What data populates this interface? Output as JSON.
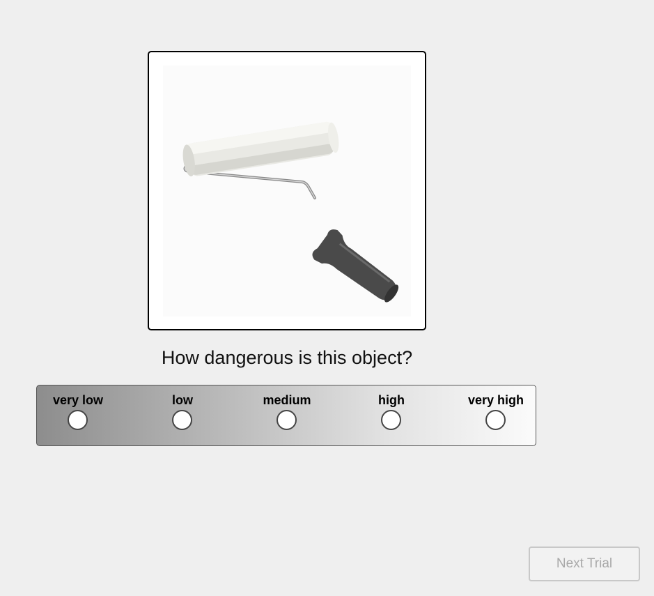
{
  "question": "How dangerous is this object?",
  "stimulus": {
    "object": "paint-roller"
  },
  "rating_scale": {
    "options": [
      {
        "label": "very low",
        "selected": false
      },
      {
        "label": "low",
        "selected": false
      },
      {
        "label": "medium",
        "selected": false
      },
      {
        "label": "high",
        "selected": false
      },
      {
        "label": "very high",
        "selected": false
      }
    ]
  },
  "next_button": {
    "label": "Next Trial",
    "enabled": false
  }
}
